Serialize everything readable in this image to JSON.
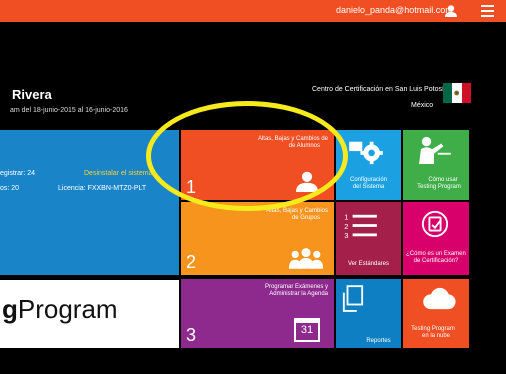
{
  "header": {
    "email": "danielo_panda@hotmail.com",
    "user_icon": "user-icon",
    "menu_icon": "hamburger-menu-icon",
    "accent": "#f04e23"
  },
  "school": {
    "name": "Rivera",
    "exam_period": "am del 18-junio-2015 al 16-junio-2016"
  },
  "center": {
    "name": "Centro de Certificación en San Luis Potosí",
    "country": "México"
  },
  "license": {
    "registered": "egistrar: 24",
    "uninstall": "Desinstalar el sistema",
    "available": "os: 20",
    "license_key": "Licencia: FXXBN-MTZ0-PLT"
  },
  "logo": {
    "bold": "g",
    "rest": "Program"
  },
  "tiles": {
    "altas_alumnos": {
      "title_line1": "Altas, Bajas y Cambios de",
      "title_line2": "de Alumnos",
      "number": "1",
      "icon": "person-icon",
      "color": "#f04e23"
    },
    "altas_grupos": {
      "title_line1": "Altas, Bajas y Cambios",
      "title_line2": "de Grupos",
      "number": "2",
      "icon": "group-icon",
      "color": "#f7941d"
    },
    "programar": {
      "title_line1": "Programar Exámenes y",
      "title_line2": "Administrar la Agenda",
      "number": "3",
      "icon": "calendar-icon",
      "calendar_day": "31",
      "color": "#8e2a8e"
    },
    "configuracion": {
      "label_line1": "Configuración",
      "label_line2": "del Sistema",
      "icon": "gear-icon",
      "color": "#1ba1e2"
    },
    "como_usar": {
      "label_line1": "Cómo usar",
      "label_line2": "Testing Program",
      "icon": "presenter-icon",
      "color": "#3fae49"
    },
    "estandares": {
      "label": "Ver Estándares",
      "icon": "numbered-list-icon",
      "color": "#a4204a"
    },
    "examen": {
      "label_line1": "¿Cómo es un  Examen",
      "label_line2": "de Certificación?",
      "icon": "exam-icon",
      "color": "#d8006b"
    },
    "reportes": {
      "label": "Reportes",
      "icon": "documents-icon",
      "color": "#0f7fc4"
    },
    "nube": {
      "label_line1": "Testing Program",
      "label_line2": "en la nube",
      "icon": "cloud-icon",
      "color": "#f04e23"
    }
  },
  "annotation": {
    "ring_color": "#f6ea1c"
  }
}
